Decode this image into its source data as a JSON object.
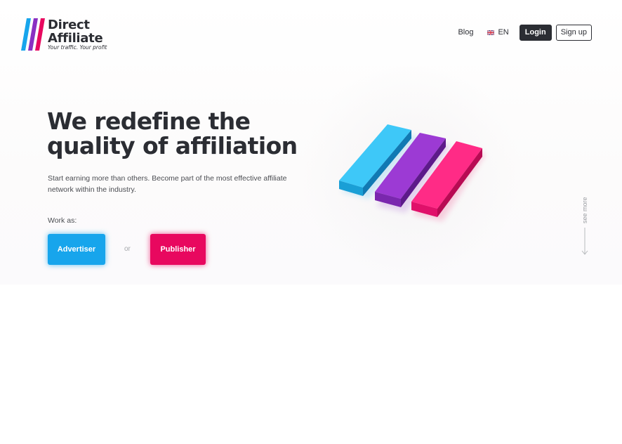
{
  "brand": {
    "name_line1": "Direct",
    "name_line2": "Affiliate",
    "tagline": "Your traffic. Your profit",
    "colors": {
      "blue": "#17a5ec",
      "purple": "#8a2fc2",
      "pink": "#e8085f",
      "dark": "#2b2d33"
    }
  },
  "nav": {
    "blog": "Blog",
    "lang": "EN",
    "lang_icon": "uk-flag-icon",
    "login": "Login",
    "signup": "Sign up"
  },
  "hero": {
    "title": "We redefine the quality of affiliation",
    "subtitle": "Start earning more than others. Become part of the most effective affiliate network within the industry.",
    "work_as": "Work as:",
    "advertiser": "Advertiser",
    "or": "or",
    "publisher": "Publisher"
  },
  "scroll": {
    "label": "see more",
    "icon": "arrow-down-icon"
  }
}
